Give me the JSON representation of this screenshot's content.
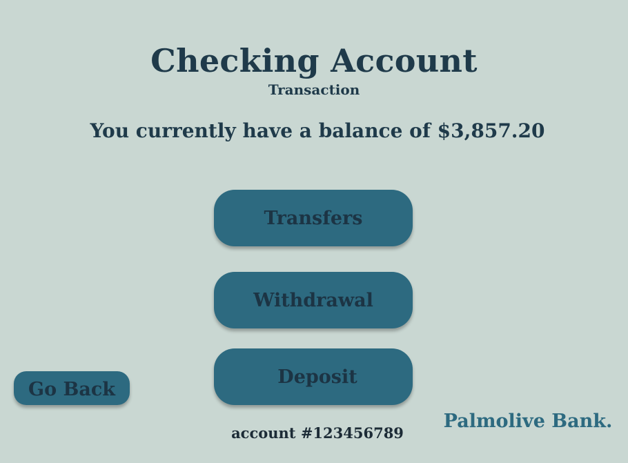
{
  "header": {
    "title": "Checking Account",
    "subtitle": "Transaction"
  },
  "balance_message": "You currently have a balance of $3,857.20",
  "actions": {
    "transfers_label": "Transfers",
    "withdrawal_label": "Withdrawal",
    "deposit_label": "Deposit"
  },
  "navigation": {
    "back_label": "Go Back"
  },
  "footer": {
    "account_number": "account #123456789",
    "brand": "Palmolive Bank."
  },
  "colors": {
    "background": "#c9d7d2",
    "button": "#2d6a80",
    "text_dark": "#1f3a4a",
    "brand": "#2d6a80"
  }
}
